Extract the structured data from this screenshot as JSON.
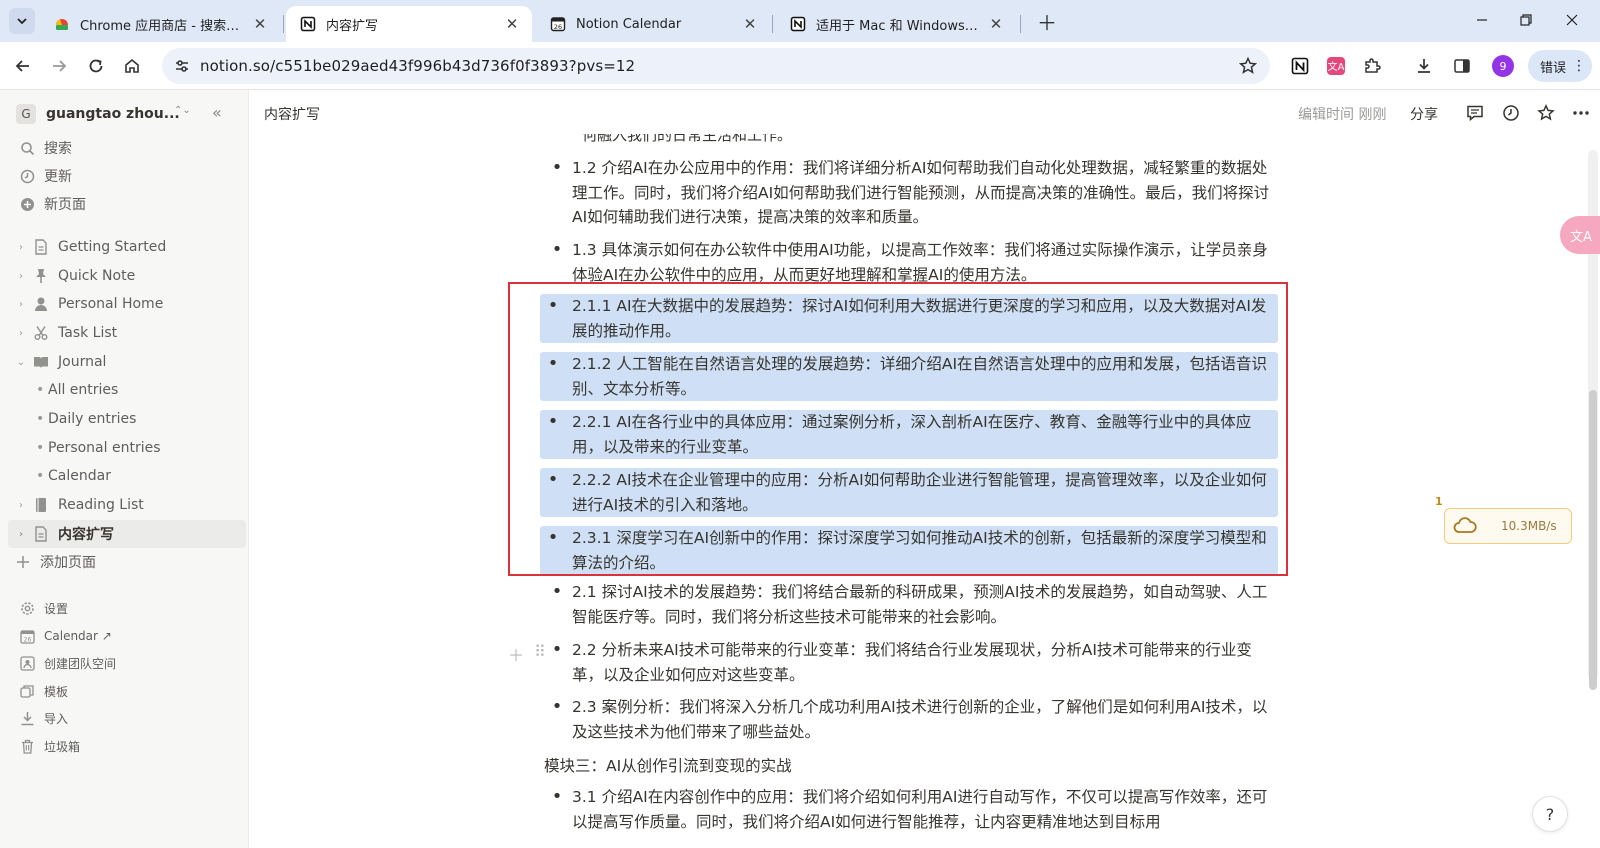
{
  "browser": {
    "tabs": [
      {
        "label": "Chrome 应用商店 - 搜索结果",
        "icon": "chrome-store-icon",
        "active": false
      },
      {
        "label": "内容扩写",
        "icon": "notion-icon",
        "active": true
      },
      {
        "label": "Notion Calendar",
        "icon": "calendar-icon",
        "active": false
      },
      {
        "label": "适用于 Mac 和 Windows 的 Notion",
        "icon": "notion-icon",
        "active": false
      }
    ],
    "url": "notion.so/c551be029aed43f996b43d736f0f3893?pvs=12",
    "profile_initial": "9",
    "error_label": "错误"
  },
  "sidebar": {
    "workspace_initial": "G",
    "workspace_name": "guangtao zhou...",
    "top_items": [
      {
        "label": "搜索",
        "icon": "search-icon"
      },
      {
        "label": "更新",
        "icon": "clock-icon"
      },
      {
        "label": "新页面",
        "icon": "plus-circle-icon"
      }
    ],
    "pages": [
      {
        "label": "Getting Started",
        "icon": "page-icon"
      },
      {
        "label": "Quick Note",
        "icon": "pin-icon"
      },
      {
        "label": "Personal Home",
        "icon": "person-icon"
      },
      {
        "label": "Task List",
        "icon": "scissors-icon"
      },
      {
        "label": "Journal",
        "icon": "book-icon"
      },
      {
        "label": "All entries"
      },
      {
        "label": "Daily entries"
      },
      {
        "label": "Personal entries"
      },
      {
        "label": "Calendar"
      },
      {
        "label": "Reading List",
        "icon": "book-icon"
      },
      {
        "label": "内容扩写",
        "icon": "page-icon"
      }
    ],
    "add_page": "添加页面",
    "bottom_items": [
      {
        "label": "设置",
        "icon": "gear-icon"
      },
      {
        "label": "Calendar ↗",
        "icon": "calendar-icon"
      },
      {
        "label": "创建团队空间",
        "icon": "team-icon"
      },
      {
        "label": "模板",
        "icon": "template-icon"
      },
      {
        "label": "导入",
        "icon": "import-icon"
      },
      {
        "label": "垃圾箱",
        "icon": "trash-icon"
      }
    ]
  },
  "header": {
    "breadcrumb": "内容扩写",
    "edited": "编辑时间 刚刚",
    "share": "分享"
  },
  "content": {
    "fragment": "何融入我们的日常生活和工作。",
    "blocks": [
      {
        "text": "1.2 介绍AI在办公应用中的作用：我们将详细分析AI如何帮助我们自动化处理数据，减轻繁重的数据处理工作。同时，我们将介绍AI如何帮助我们进行智能预测，从而提高决策的准确性。最后，我们将探讨AI如何辅助我们进行决策，提高决策的效率和质量。"
      },
      {
        "text": "1.3 具体演示如何在办公软件中使用AI功能，以提高工作效率：我们将通过实际操作演示，让学员亲身体验AI在办公软件中的应用，从而更好地理解和掌握AI的使用方法。"
      },
      {
        "text": "2.1.1 AI在大数据中的发展趋势：探讨AI如何利用大数据进行更深度的学习和应用，以及大数据对AI发展的推动作用。",
        "selected": true
      },
      {
        "text": "2.1.2 人工智能在自然语言处理的发展趋势：详细介绍AI在自然语言处理中的应用和发展，包括语音识别、文本分析等。",
        "selected": true
      },
      {
        "text": "2.2.1 AI在各行业中的具体应用：通过案例分析，深入剖析AI在医疗、教育、金融等行业中的具体应用，以及带来的行业变革。",
        "selected": true
      },
      {
        "text": "2.2.2 AI技术在企业管理中的应用：分析AI如何帮助企业进行智能管理，提高管理效率，以及企业如何进行AI技术的引入和落地。",
        "selected": true
      },
      {
        "text": "2.3.1 深度学习在AI创新中的作用：探讨深度学习如何推动AI技术的创新，包括最新的深度学习模型和算法的介绍。",
        "selected": true
      },
      {
        "text": "2.1 探讨AI技术的发展趋势：我们将结合最新的科研成果，预测AI技术的发展趋势，如自动驾驶、人工智能医疗等。同时，我们将分析这些技术可能带来的社会影响。"
      },
      {
        "text": "2.2 分析未来AI技术可能带来的行业变革：我们将结合行业发展现状，分析AI技术可能带来的行业变革，以及企业如何应对这些变革。"
      },
      {
        "text": "2.3 案例分析：我们将深入分析几个成功利用AI技术进行创新的企业，了解他们是如何利用AI技术，以及这些技术为他们带来了哪些益处。"
      }
    ],
    "section_heading": "模块三：AI从创作引流到变现的实战",
    "last_block": "3.1 介绍AI在内容创作中的应用：我们将介绍如何利用AI进行自动写作，不仅可以提高写作效率，还可以提高写作质量。同时，我们将介绍AI如何进行智能推荐，让内容更精准地达到目标用"
  },
  "overlays": {
    "translate_label": "文A",
    "net_count": "1",
    "net_speed": "10.3MB/s",
    "help": "?"
  },
  "colors": {
    "selection": "#cfe0f6",
    "annotation_box": "#d9323a",
    "sidebar_bg": "#f7f7f5",
    "tabstrip_bg": "#dfe8f6"
  }
}
